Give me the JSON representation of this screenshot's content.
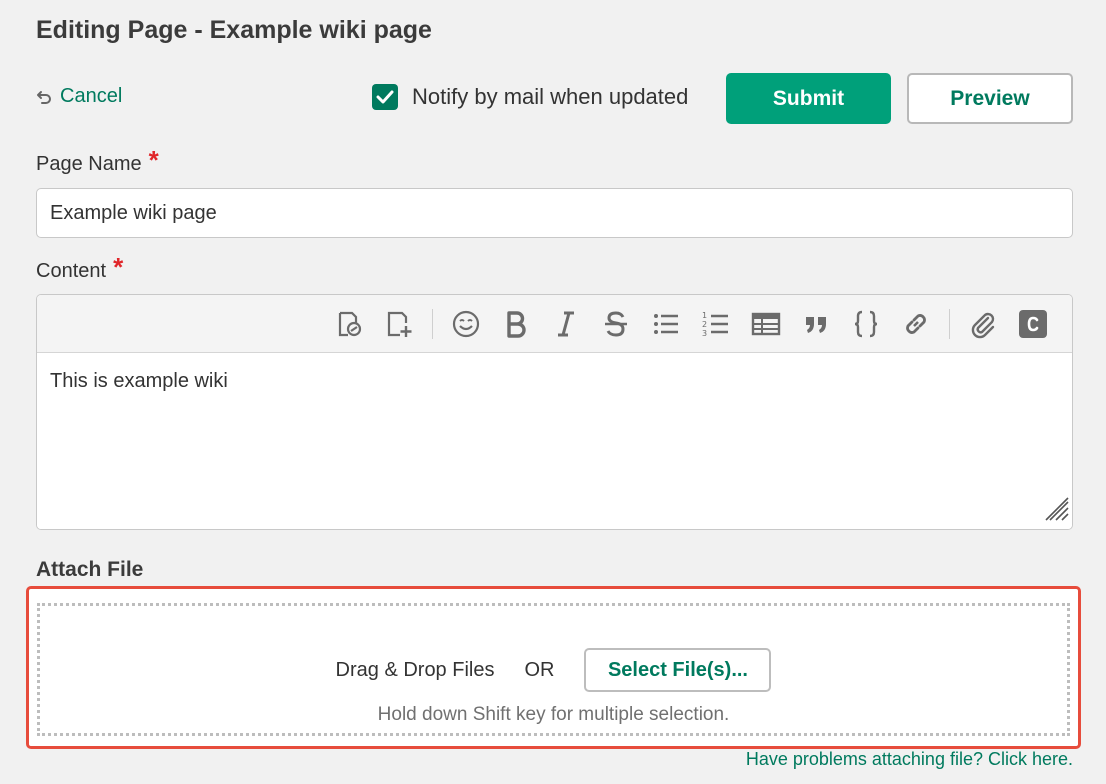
{
  "header": {
    "title": "Editing Page - Example wiki page"
  },
  "actions": {
    "cancel_label": "Cancel",
    "notify_label": "Notify by mail when updated",
    "notify_checked": true,
    "submit_label": "Submit",
    "preview_label": "Preview"
  },
  "form": {
    "page_name_label": "Page Name",
    "page_name_value": "Example wiki page",
    "required_mark": "*",
    "content_label": "Content",
    "content_value": "This is example wiki"
  },
  "toolbar": {
    "icons": [
      "wiki-link-icon",
      "add-page-icon",
      "emoji-icon",
      "bold-icon",
      "italic-icon",
      "strikethrough-icon",
      "bullet-list-icon",
      "numbered-list-icon",
      "table-icon",
      "quote-icon",
      "code-icon",
      "link-icon",
      "attachment-icon",
      "color-icon"
    ],
    "icon_color": "#6b6b6b"
  },
  "attach": {
    "title": "Attach File",
    "drag_drop_label": "Drag & Drop Files",
    "or_label": "OR",
    "select_label": "Select File(s)...",
    "hint": "Hold down Shift key for multiple selection.",
    "help_link": "Have problems attaching file? Click here."
  },
  "colors": {
    "accent": "#007a5e",
    "submit_bg": "#00a07a",
    "required": "#e0262a",
    "highlight_border": "#e74c3c"
  }
}
